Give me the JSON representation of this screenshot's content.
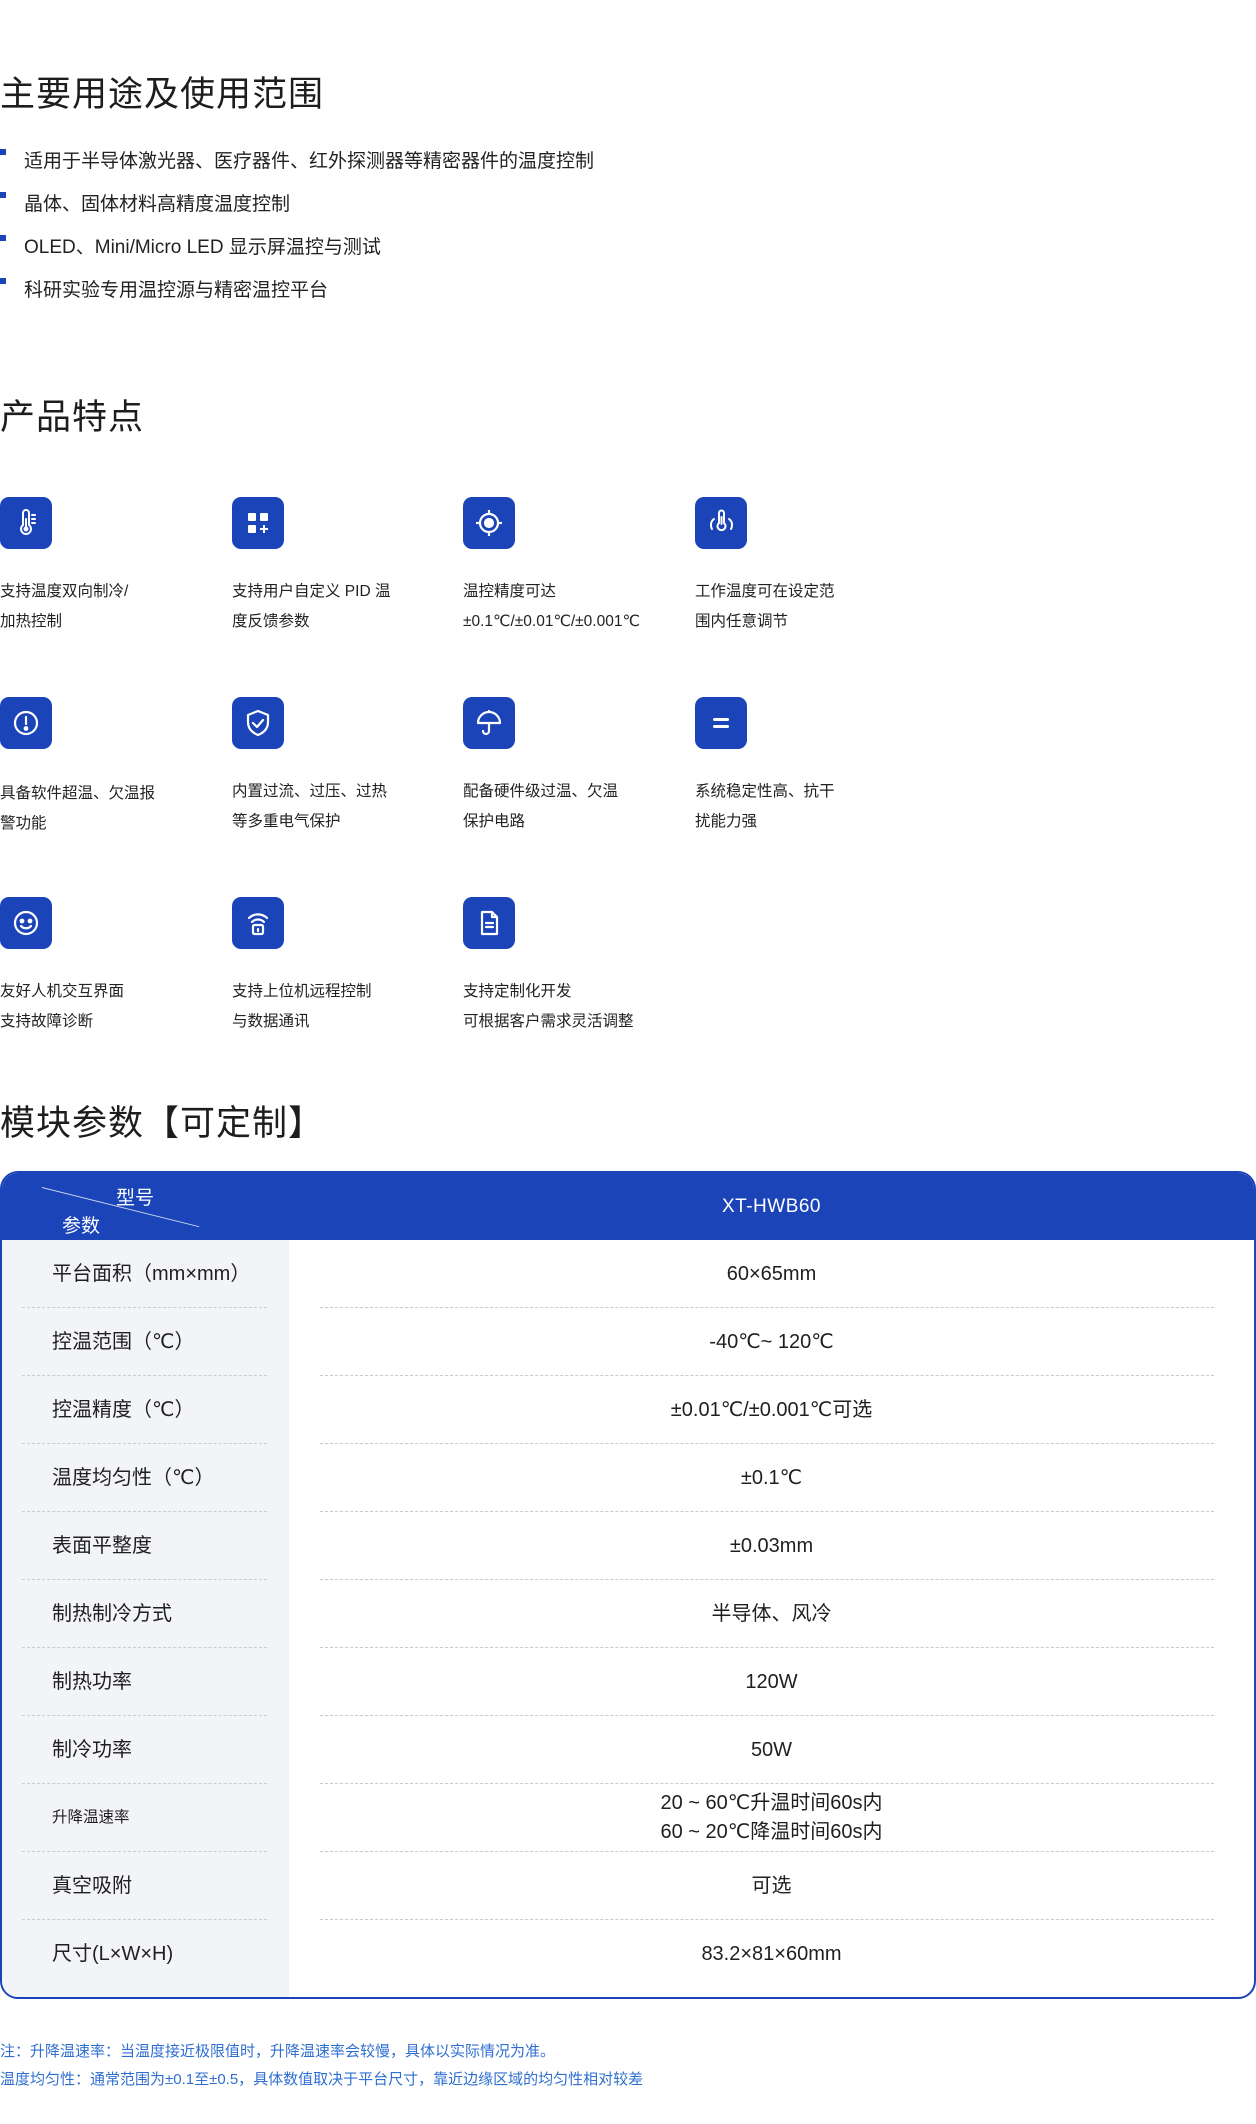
{
  "usage": {
    "title": "主要用途及使用范围",
    "items": [
      "适用于半导体激光器、医疗器件、红外探测器等精密器件的温度控制",
      "晶体、固体材料高精度温度控制",
      "OLED、Mini/Micro LED 显示屏温控与测试",
      "科研实验专用温控源与精密温控平台"
    ]
  },
  "features": {
    "title": "产品特点",
    "items": [
      {
        "icon": "thermometer-icon",
        "line1": "支持温度双向制冷/",
        "line2": "加热控制"
      },
      {
        "icon": "grid-plus-icon",
        "line1": "支持用户自定义 PID 温",
        "line2": "度反馈参数"
      },
      {
        "icon": "target-icon",
        "line1": "温控精度可达",
        "line2": "±0.1℃/±0.01℃/±0.001℃"
      },
      {
        "icon": "thermometer-hand-icon",
        "line1": "工作温度可在设定范",
        "line2": "围内任意调节"
      },
      {
        "icon": "alert-circle-icon",
        "line1": "具备软件超温、欠温报",
        "line2": "警功能"
      },
      {
        "icon": "shield-check-icon",
        "line1": "内置过流、过压、过热",
        "line2": "等多重电气保护"
      },
      {
        "icon": "umbrella-icon",
        "line1": "配备硬件级过温、欠温",
        "line2": "保护电路"
      },
      {
        "icon": "equals-icon",
        "line1": "系统稳定性高、抗干",
        "line2": "扰能力强"
      },
      {
        "icon": "smiley-icon",
        "line1": "友好人机交互界面",
        "line2": "支持故障诊断"
      },
      {
        "icon": "remote-signal-icon",
        "line1": "支持上位机远程控制",
        "line2": "与数据通讯"
      },
      {
        "icon": "document-icon",
        "line1": "支持定制化开发",
        "line2": "可根据客户需求灵活调整"
      }
    ]
  },
  "params": {
    "title": "模块参数【可定制】",
    "header": {
      "model_label": "型号",
      "param_label": "参数",
      "model_value": "XT-HWB60"
    },
    "rows": [
      {
        "label": "平台面积（mm×mm）",
        "value": [
          "60×65mm"
        ]
      },
      {
        "label": "控温范围（℃）",
        "value": [
          "-40℃~ 120℃"
        ]
      },
      {
        "label": "控温精度（℃）",
        "value": [
          "±0.01℃/±0.001℃可选"
        ]
      },
      {
        "label": "温度均匀性（℃）",
        "value": [
          "±0.1℃"
        ]
      },
      {
        "label": "表面平整度",
        "value": [
          "±0.03mm"
        ]
      },
      {
        "label": "制热制冷方式",
        "value": [
          "半导体、风冷"
        ]
      },
      {
        "label": "制热功率",
        "value": [
          "120W"
        ]
      },
      {
        "label": "制冷功率",
        "value": [
          "50W"
        ]
      },
      {
        "label": "升降温速率",
        "value": [
          "20 ~ 60℃升温时间60s内",
          "60 ~ 20℃降温时间60s内"
        ]
      },
      {
        "label": "真空吸附",
        "value": [
          "可选"
        ]
      },
      {
        "label": "尺寸(L×W×H)",
        "value": [
          "83.2×81×60mm"
        ]
      }
    ]
  },
  "notes": [
    "注：升降温速率：当温度接近极限值时，升降温速率会较慢，具体以实际情况为准。",
    "温度均匀性：通常范围为±0.1至±0.5，具体数值取决于平台尺寸，靠近边缘区域的均匀性相对较差"
  ],
  "colors": {
    "accent": "#1a44b8",
    "note": "#2f6fd1",
    "label_bg": "#f3f4f8"
  }
}
